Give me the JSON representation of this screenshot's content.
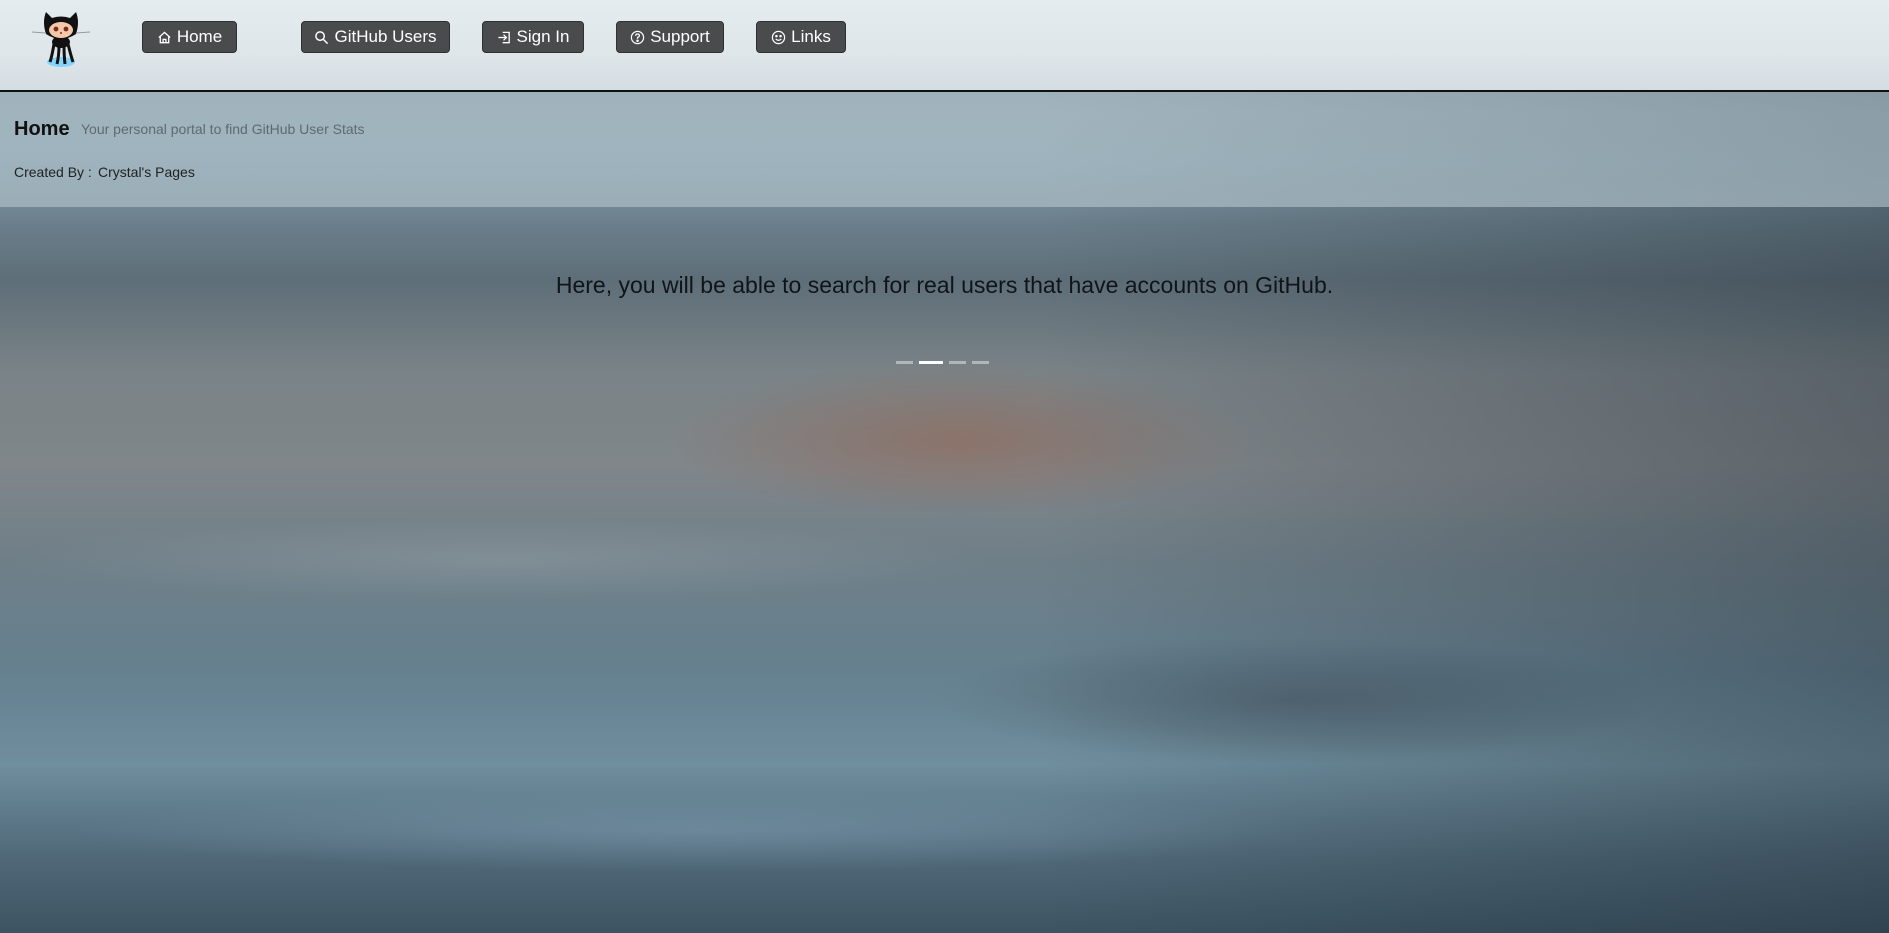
{
  "nav": {
    "logo_icon": "github-octocat-logo",
    "items": [
      {
        "label": "Home",
        "icon": "home-icon"
      },
      {
        "label": "GitHub Users",
        "icon": "search-icon"
      },
      {
        "label": "Sign In",
        "icon": "sign-in-icon"
      },
      {
        "label": "Support",
        "icon": "question-circle-icon"
      },
      {
        "label": "Links",
        "icon": "smiley-icon"
      }
    ]
  },
  "header": {
    "title": "Home",
    "subtitle": "Your personal portal to find GitHub User Stats",
    "created_by_label": "Created By :",
    "created_by_value": "Crystal's Pages"
  },
  "carousel": {
    "text": "Here, you will be able to search for real users that have accounts on GitHub.",
    "slide_count": 4,
    "active_index": 1
  },
  "colors": {
    "nav_button_bg": "#4a4b4d",
    "nav_button_text": "#ffffff"
  }
}
